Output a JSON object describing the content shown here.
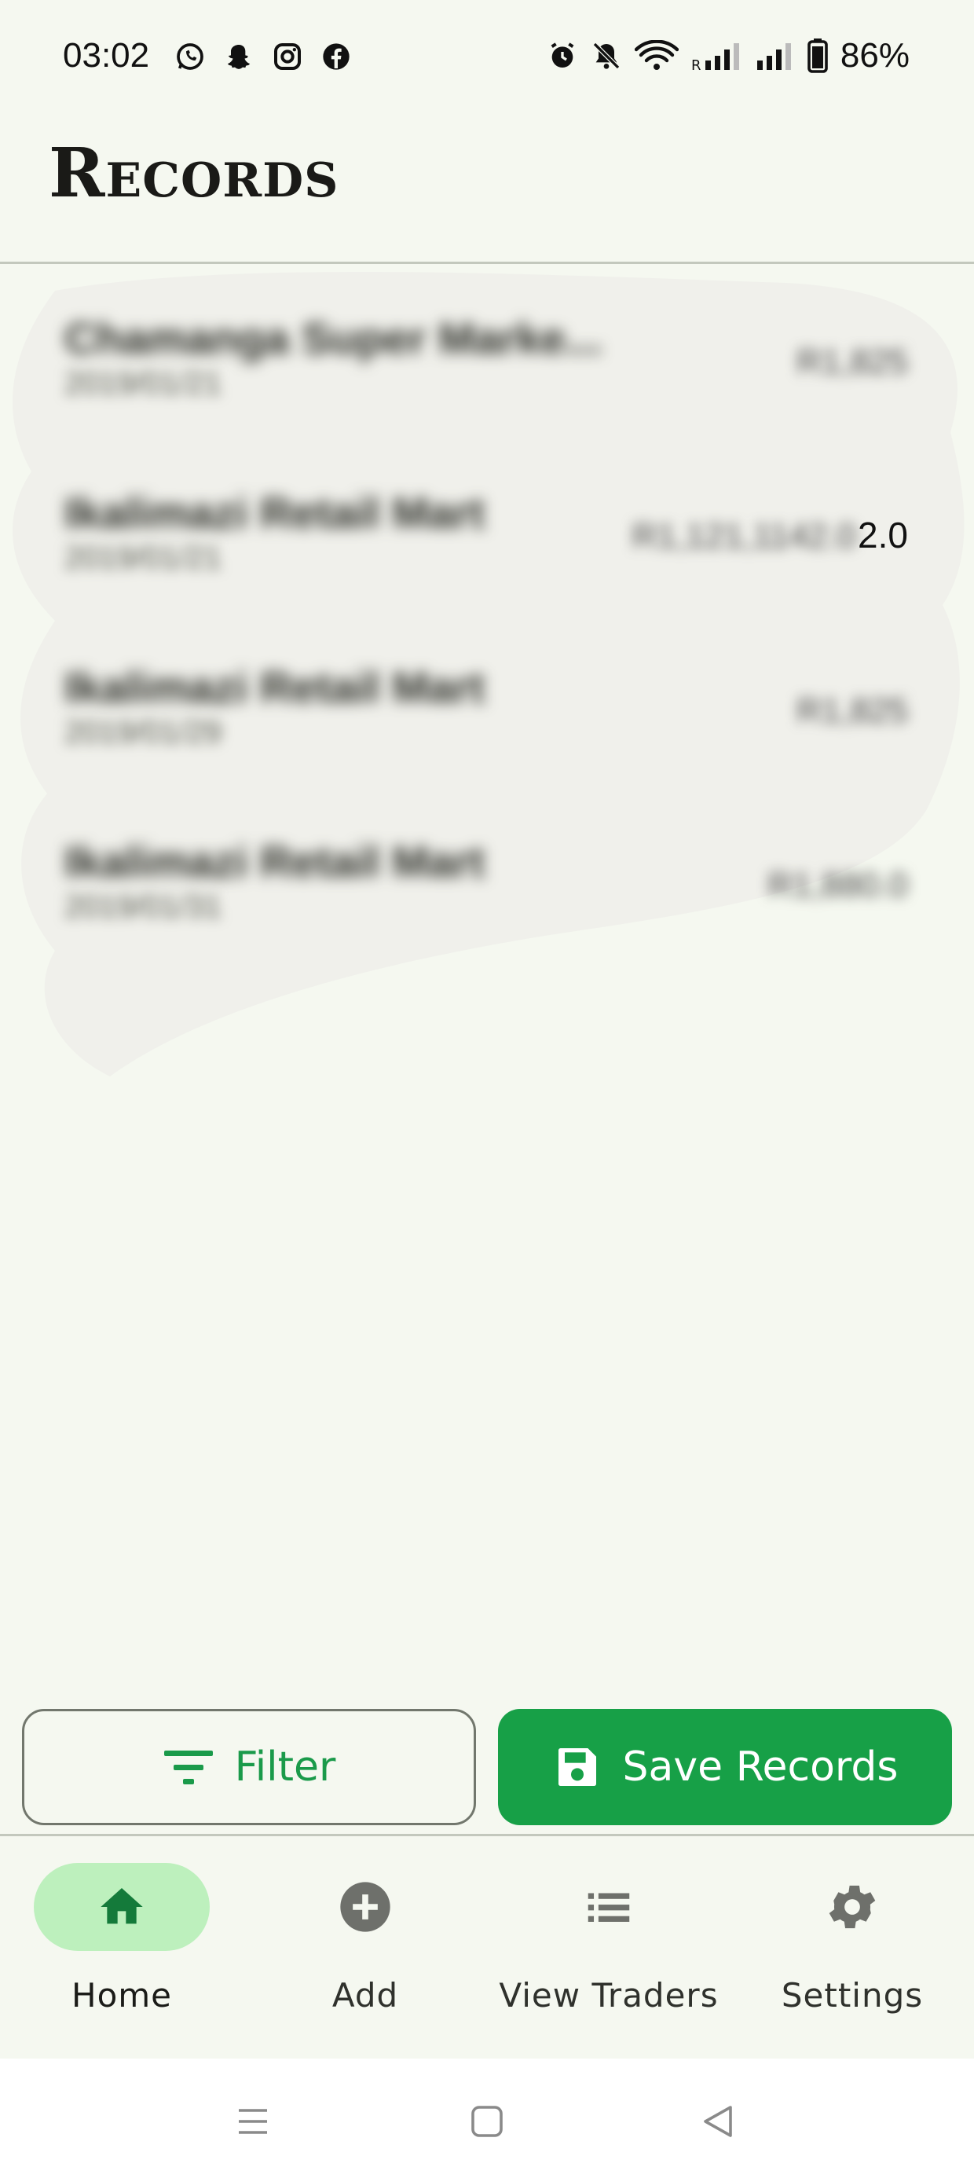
{
  "status_bar": {
    "time": "03:02",
    "battery_percent": "86%",
    "left_icons": [
      "whatsapp-icon",
      "snapchat-icon",
      "instagram-icon",
      "facebook-icon"
    ],
    "right_icons": [
      "alarm-icon",
      "bell-off-icon",
      "wifi-icon",
      "signal-r-icon",
      "signal-icon",
      "battery-icon"
    ]
  },
  "app_bar": {
    "title": "Records"
  },
  "records": [
    {
      "name": "Chamanga Super Marke...",
      "date": "2019/01/21",
      "amount": "R1,825"
    },
    {
      "name": "Ikalimazi Retail Mart",
      "date": "2019/01/21",
      "amount": "R1,121,1142.0",
      "visible_suffix": "2.0"
    },
    {
      "name": "Ikalimazi Retail Mart",
      "date": "2019/01/29",
      "amount": "R1,825"
    },
    {
      "name": "Ikalimazi Retail Mart",
      "date": "2019/01/31",
      "amount": "R1,880.0"
    }
  ],
  "actions": {
    "filter_label": "Filter",
    "save_label": "Save Records"
  },
  "bottom_nav": {
    "items": [
      {
        "label": "Home",
        "icon": "home-icon",
        "active": true
      },
      {
        "label": "Add",
        "icon": "add-circle-icon",
        "active": false
      },
      {
        "label": "View Traders",
        "icon": "list-icon",
        "active": false
      },
      {
        "label": "Settings",
        "icon": "gear-icon",
        "active": false
      }
    ]
  },
  "colors": {
    "background": "#f5f8f0",
    "accent_green": "#17a047",
    "active_pill": "#bdf0bd",
    "icon_grey": "#6e706b",
    "divider": "#c3c8bd"
  }
}
